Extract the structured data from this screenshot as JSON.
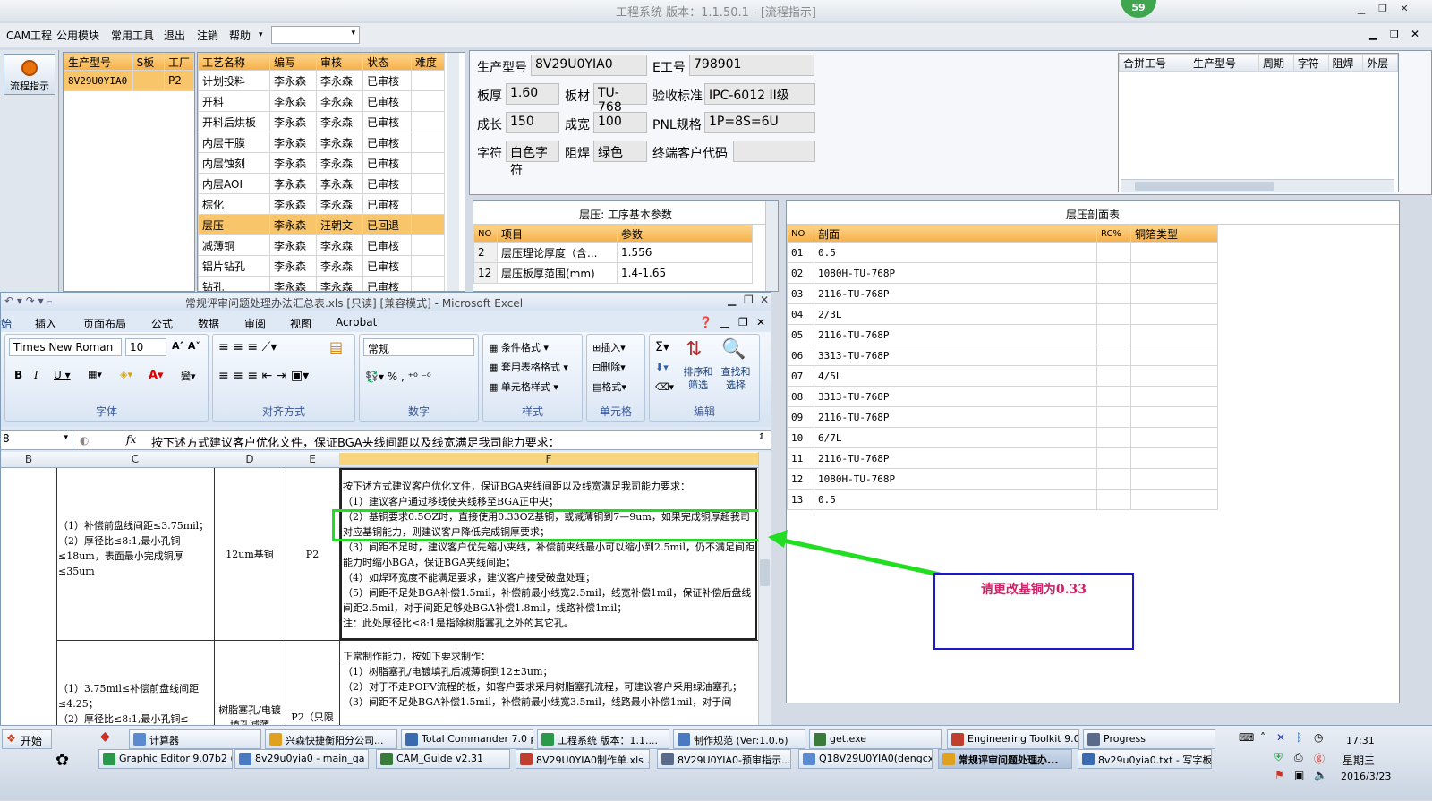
{
  "window": {
    "title": "工程系统  版本：1.1.50.1 - [流程指示]",
    "badge": "59"
  },
  "menu": {
    "items": [
      "CAM工程",
      "公用模块",
      "常用工具",
      "退出",
      "注销",
      "帮助"
    ],
    "dropdown_value": ""
  },
  "nav": {
    "flow_button": "流程指示"
  },
  "model_list": {
    "headers": [
      "生产型号",
      "S板",
      "工厂"
    ],
    "rows": [
      [
        "8V29U0YIA0",
        "",
        "P2"
      ]
    ]
  },
  "process_list": {
    "headers": [
      "工艺名称",
      "编写",
      "审核",
      "状态",
      "难度"
    ],
    "rows": [
      [
        "计划投料",
        "李永森",
        "李永森",
        "已审核",
        ""
      ],
      [
        "开料",
        "李永森",
        "李永森",
        "已审核",
        ""
      ],
      [
        "开料后烘板",
        "李永森",
        "李永森",
        "已审核",
        ""
      ],
      [
        "内层干膜",
        "李永森",
        "李永森",
        "已审核",
        ""
      ],
      [
        "内层蚀刻",
        "李永森",
        "李永森",
        "已审核",
        ""
      ],
      [
        "内层AOI",
        "李永森",
        "李永森",
        "已审核",
        ""
      ],
      [
        "棕化",
        "李永森",
        "李永森",
        "已审核",
        ""
      ],
      [
        "层压",
        "李永森",
        "汪朝文",
        "已回退",
        ""
      ],
      [
        "减薄铜",
        "李永森",
        "李永森",
        "已审核",
        ""
      ],
      [
        "铝片钻孔",
        "李永森",
        "李永森",
        "已审核",
        ""
      ],
      [
        "钻孔",
        "李永森",
        "李永森",
        "已审核",
        ""
      ]
    ]
  },
  "info": {
    "model_label": "生产型号",
    "model_value": "8V29U0YIA0",
    "e_label": "E工号",
    "e_value": "798901",
    "thick_label": "板厚",
    "thick_value": "1.60",
    "material_label": "板材",
    "material_value": "TU-768",
    "std_label": "验收标准",
    "std_value": "IPC-6012 II级",
    "len_label": "成长",
    "len_value": "150",
    "wid_label": "成宽",
    "wid_value": "100",
    "pnl_label": "PNL规格",
    "pnl_value": "1P=8S=6U",
    "char_label": "字符",
    "char_value": "白色字符",
    "mask_label": "阻焊",
    "mask_value": "绿色",
    "cust_label": "终端客户代码",
    "cust_value": ""
  },
  "merge_table": {
    "headers": [
      "合拼工号",
      "生产型号",
      "周期",
      "字符",
      "阻焊",
      "外层"
    ]
  },
  "params": {
    "title": "层压: 工序基本参数",
    "headers": [
      "NO",
      "项目",
      "参数"
    ],
    "rows": [
      [
        "2",
        "层压理论厚度（含...",
        "1.556"
      ],
      [
        "12",
        "层压板厚范围(mm)",
        "1.4-1.65"
      ]
    ]
  },
  "stackup": {
    "title": "层压剖面表",
    "headers": [
      "NO",
      "剖面",
      "RC%",
      "铜箔类型"
    ],
    "rows": [
      [
        "01",
        "0.5"
      ],
      [
        "02",
        "1080H-TU-768P"
      ],
      [
        "03",
        "2116-TU-768P"
      ],
      [
        "04",
        "2/3L"
      ],
      [
        "05",
        "2116-TU-768P"
      ],
      [
        "06",
        "3313-TU-768P"
      ],
      [
        "07",
        "4/5L"
      ],
      [
        "08",
        "3313-TU-768P"
      ],
      [
        "09",
        "2116-TU-768P"
      ],
      [
        "10",
        "6/7L"
      ],
      [
        "11",
        "2116-TU-768P"
      ],
      [
        "12",
        "1080H-TU-768P"
      ],
      [
        "13",
        "0.5"
      ]
    ]
  },
  "excel": {
    "title": "常规评审问题处理办法汇总表.xls [只读] [兼容模式] - Microsoft Excel",
    "tabs": [
      "始",
      "插入",
      "页面布局",
      "公式",
      "数据",
      "审阅",
      "视图",
      "Acrobat"
    ],
    "font": "Times New Roman",
    "size": "10",
    "numfmt": "常规",
    "groups": [
      "字体",
      "对齐方式",
      "数字",
      "样式",
      "单元格",
      "编辑"
    ],
    "style_btns": [
      "条件格式",
      "套用表格格式",
      "单元格样式"
    ],
    "cell_btns": [
      "插入",
      "删除",
      "格式"
    ],
    "edit_btns": [
      "排序和筛选",
      "查找和选择"
    ],
    "namebox": "8",
    "formula": "按下述方式建议客户优化文件，保证BGA夹线间距以及线宽满足我司能力要求：",
    "columns": [
      "B",
      "C",
      "D",
      "E",
      "F"
    ],
    "row1": {
      "c": "（1）补偿前盘线间距≤3.75mil；\n（2）厚径比≤8:1,最小孔铜≤18um，表面最小完成铜厚≤35um",
      "d": "12um基铜",
      "e": "P2",
      "f": "按下述方式建议客户优化文件，保证BGA夹线间距以及线宽满足我司能力要求：\n（1）建议客户通过移线使夹线移至BGA正中央；\n（2）基铜要求0.5OZ时，直接使用0.33OZ基铜，或减薄铜到7—9um，如果完成铜厚超我司对应基铜能力，则建议客户降低完成铜厚要求；\n（3）间距不足时，建议客户优先缩小夹线，补偿前夹线最小可以缩小到2.5mil，仍不满足间距能力时缩小BGA，保证BGA夹线间距；\n（4）如焊环宽度不能满足要求，建议客户接受破盘处理；\n（5）间距不足处BGA补偿1.5mil，补偿前最小线宽2.5mil，线宽补偿1mil，保证补偿后盘线间距2.5mil，对于间距足够处BGA补偿1.8mil，线路补偿1mil；\n注：此处厚径比≤8:1是指除树脂塞孔之外的其它孔。"
    },
    "row2": {
      "c": "（1）3.75mil≤补偿前盘线间距≤4.25；\n（2）厚径比≤8:1,最小孔铜≤",
      "d": "树脂塞孔/电镀填孔减薄",
      "e": "P2（只限",
      "f": "正常制作能力，按如下要求制作：\n（1）树脂塞孔/电镀填孔后减薄铜到12±3um；\n（2）对于不走POFV流程的板，如客户要求采用树脂塞孔流程，可建议客户采用绿油塞孔；\n（3）间距不足处BGA补偿1.5mil，补偿前最小线宽3.5mil，线路最小补偿1mil，对于间"
    }
  },
  "annotation": {
    "text": "请更改基铜为0.33",
    "color": "#cc2266",
    "arrow_color": "#22dd22"
  },
  "taskbar": {
    "start": "开始",
    "row1": [
      "计算器",
      "兴森快捷衡阳分公司...",
      "Total Commander 7.0 p...",
      "工程系统  版本：1.1....",
      "制作规范 (Ver:1.0.6)",
      "get.exe",
      "Engineering Toolkit 9.0...",
      "Progress"
    ],
    "row2": [
      "Graphic Editor 9.07b2 (0...",
      "8v29u0yia0 - main_qa",
      "CAM_Guide v2.31",
      "8V29U0YIA0制作单.xls ...",
      "8V29U0YIA0-预审指示....",
      "Q18V29U0YIA0(dengcx)...",
      "常规评审问题处理办...",
      "8v29u0yia0.txt - 写字板"
    ],
    "time": "17:31",
    "weekday": "星期三",
    "date": "2016/3/23"
  }
}
